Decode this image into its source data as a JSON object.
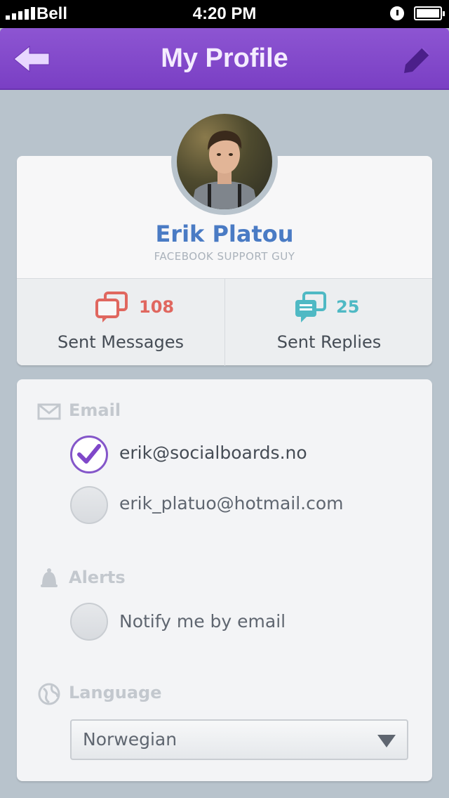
{
  "status_bar": {
    "carrier": "Bell",
    "time": "4:20 PM",
    "icons": [
      "signal-icon",
      "alarm-icon",
      "battery-icon"
    ]
  },
  "nav": {
    "title": "My Profile",
    "back_icon": "back-arrow-icon",
    "edit_icon": "pencil-icon"
  },
  "profile": {
    "name": "Erik Platou",
    "subtitle": "FACEBOOK  SUPPORT GUY"
  },
  "stats": [
    {
      "count": "108",
      "label": "Sent Messages",
      "color": "#e0675f",
      "icon": "messages-icon"
    },
    {
      "count": "25",
      "label": "Sent Replies",
      "color": "#4fb9c4",
      "icon": "replies-icon"
    }
  ],
  "email": {
    "title": "Email",
    "icon": "envelope-icon",
    "options": [
      {
        "label": "erik@socialboards.no",
        "checked": true
      },
      {
        "label": "erik_platuo@hotmail.com",
        "checked": false
      }
    ]
  },
  "alerts": {
    "title": "Alerts",
    "icon": "bell-icon",
    "options": [
      {
        "label": "Notify me by email",
        "checked": false
      }
    ]
  },
  "language": {
    "title": "Language",
    "icon": "globe-icon",
    "selected": "Norwegian"
  },
  "colors": {
    "accent": "#7f47c9",
    "name": "#4a7bc4",
    "background": "#b8c3cc"
  }
}
